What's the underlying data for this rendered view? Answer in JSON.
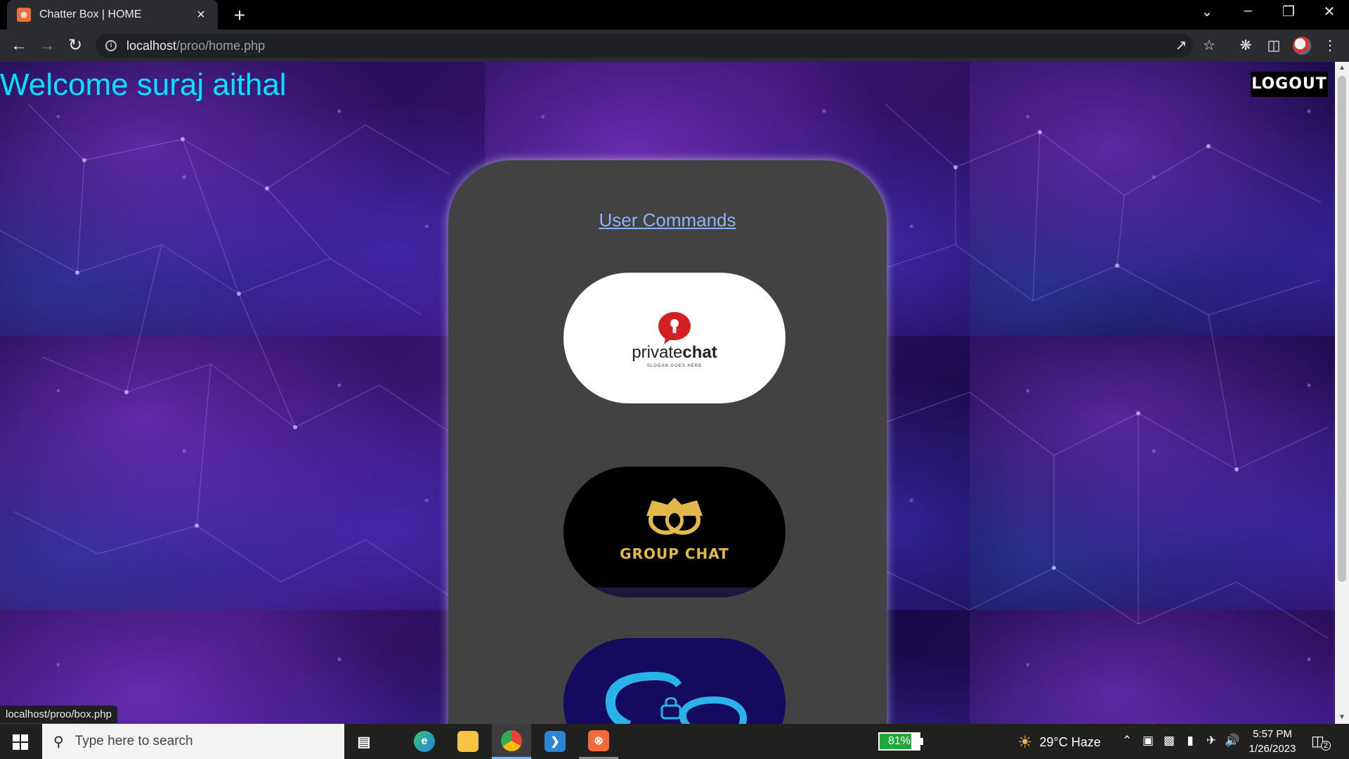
{
  "browser": {
    "tab_title": "Chatter Box | HOME",
    "tab_favicon": "xampp-icon",
    "new_tab_label": "+",
    "url_host": "localhost",
    "url_path": "/proo/home.php",
    "status_url": "localhost/proo/box.php"
  },
  "page": {
    "welcome_text": "Welcome suraj aithal",
    "logout_label": "LOGOUT",
    "panel_link": "User Commands",
    "private_chat": {
      "name_light": "private",
      "name_bold": "chat",
      "slogan": "SLOGAN GOES HERE"
    },
    "group_chat": {
      "name": "GROUP CHAT"
    },
    "colors": {
      "welcome": "#00e5ff",
      "panel": "#424242",
      "link": "#8ab4f8",
      "group_gold": "#e2b84a"
    }
  },
  "taskbar": {
    "search_placeholder": "Type here to search",
    "battery_label": "81%",
    "battery_level": 0.81,
    "weather": "29°C  Haze",
    "time": "5:57 PM",
    "date": "1/26/2023",
    "notification_count": "2",
    "apps": [
      "task-view",
      "edge",
      "file-explorer",
      "chrome",
      "vscode",
      "xampp"
    ]
  }
}
